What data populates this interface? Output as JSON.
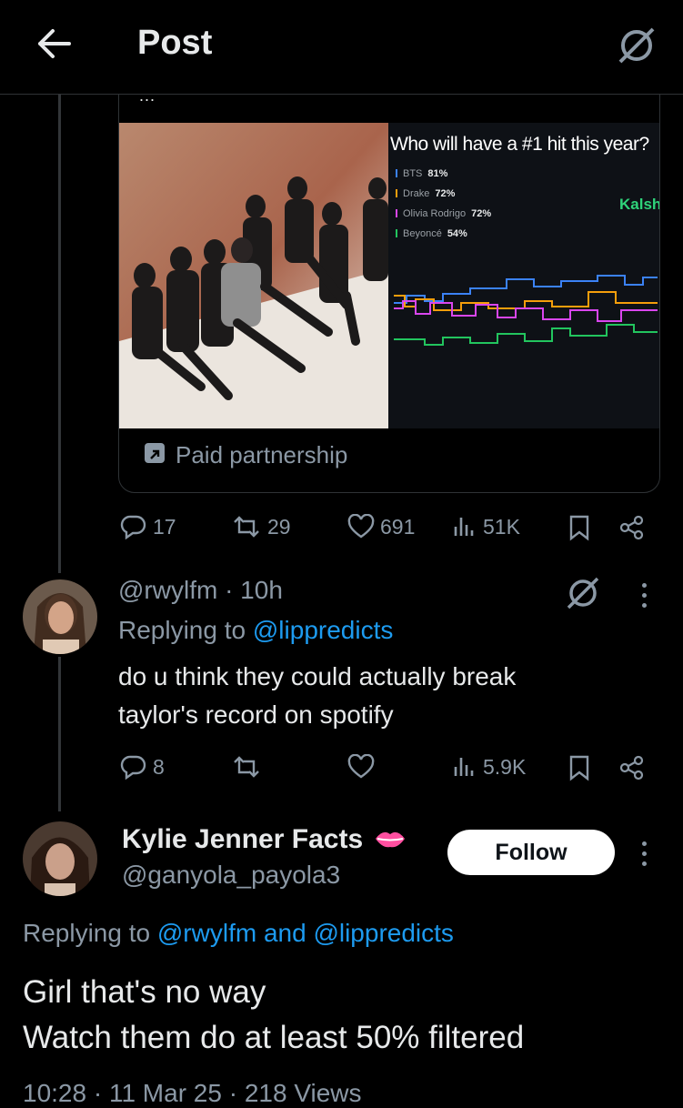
{
  "header": {
    "title": "Post",
    "back_icon": "arrow-left-icon",
    "grok_icon": "grok-slash-icon"
  },
  "quoted_card": {
    "ellipsis": "...",
    "chart_panel": {
      "title": "Who will have a #1 hit this year?",
      "brand": "Kalsh",
      "legend": [
        {
          "name": "BTS",
          "value": "81%",
          "color": "#3b82f6"
        },
        {
          "name": "Drake",
          "value": "72%",
          "color": "#f59e0b"
        },
        {
          "name": "Olivia Rodrigo",
          "value": "72%",
          "color": "#d946ef"
        },
        {
          "name": "Beyoncé",
          "value": "54%",
          "color": "#22c55e"
        }
      ]
    },
    "paid_label": "Paid partnership"
  },
  "main_actions": {
    "replies": "17",
    "reposts": "29",
    "likes": "691",
    "views": "51K"
  },
  "reply": {
    "handle_time": "@rwylfm · 10h",
    "replying_prefix": "Replying to",
    "replying_to": "@lippredicts",
    "text_line1": "do u think they could actually break",
    "text_line2": "taylor's record on spotify",
    "actions": {
      "replies": "8",
      "reposts": "",
      "likes": "",
      "views": "5.9K"
    }
  },
  "comment": {
    "name": "Kylie Jenner Facts",
    "name_emoji": "lips-icon",
    "handle": "@ganyola_payola3",
    "follow_label": "Follow",
    "replying_prefix": "Replying to",
    "replying_to": "@rwylfm and @lippredicts",
    "text_line1": "Girl that's no way",
    "text_line2": "Watch them do at least 50% filtered",
    "bottom_partial": "10:28 · 11 Mar 25 · 218 Views"
  }
}
